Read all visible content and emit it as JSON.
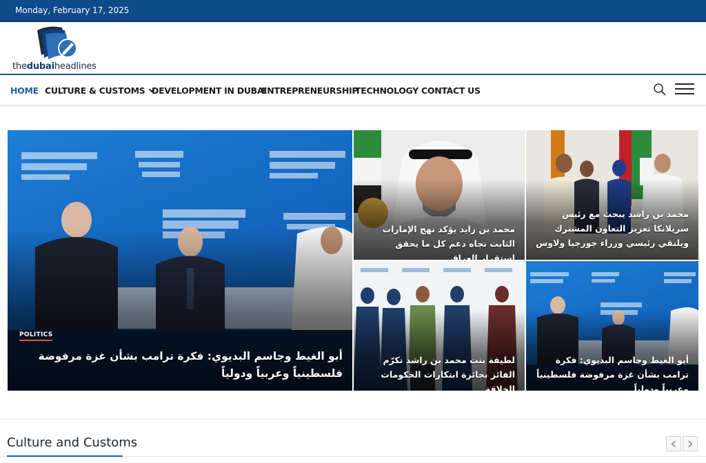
{
  "topbar": {
    "date": "Monday, February 17, 2025"
  },
  "logo": {
    "prefix": "the",
    "bold": "dubai",
    "suffix": "headlines"
  },
  "nav": {
    "items": [
      {
        "label": "HOME"
      },
      {
        "label": "CULTURE & CUSTOMS"
      },
      {
        "label": "DEVELOPMENT IN DUBAI"
      },
      {
        "label": "ENTREPRENEURSHIP"
      },
      {
        "label": "TECHNOLOGY"
      },
      {
        "label": "CONTACT US"
      }
    ]
  },
  "featured": {
    "main": {
      "category": "POLITICS",
      "headline": "أبو الغيط وجاسم البديوي: فكرة ترامب بشأن غزة مرفوضة فلسطينياً وعربياً ودولياً"
    },
    "cards": [
      {
        "headline": "محمد بن زايد يؤكد نهج الإمارات الثابت تجاه دعم كل ما يحقق استقرار العراق"
      },
      {
        "headline": "محمد بن راشد يبحث مع رئيس سريلانكا تعزيز التعاون المشترك ويلتقي رئيسي وزراء جورجيا ولاوس"
      },
      {
        "headline": "لطيفة بنت محمد بن راشد تكرّم الفائز بجائزة ابتكارات الحكومات الخلاقة"
      },
      {
        "headline": "أبو الغيط وجاسم البديوي: فكرة ترامب بشأن غزة مرفوضة فلسطينياً وعربياً ودولياً"
      }
    ]
  },
  "section": {
    "title": "Culture and Customs"
  },
  "colors": {
    "accent": "#1d5ea8",
    "topbar": "#0f4a8a",
    "badge_underline": "#e0583a"
  },
  "icons": [
    "search-icon",
    "menu-icon",
    "chevron-down-icon",
    "chevron-left-icon",
    "chevron-right-icon"
  ]
}
